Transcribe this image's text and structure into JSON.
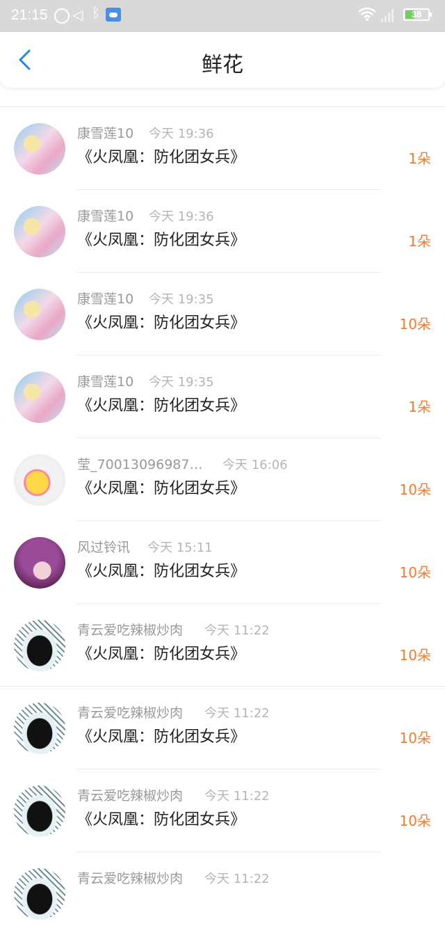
{
  "status_bar": {
    "time": "21:15",
    "battery": "38",
    "icons": [
      "alarm-icon",
      "mute-icon",
      "bluetooth-icon",
      "cloud-icon",
      "wifi-icon",
      "signal-icon",
      "battery-icon"
    ]
  },
  "header": {
    "title": "鲜花",
    "back_icon": "back-chevron-icon"
  },
  "colors": {
    "amount": "#f57c2c",
    "back_icon": "#1e88e5",
    "status_bar_bg": "#d9d9d9"
  },
  "items": [
    {
      "name": "康雪莲10",
      "time": "今天 19:36",
      "book": "《火凤凰：防化团女兵》",
      "amount": "1朵",
      "avatar": "anime-avatar"
    },
    {
      "name": "康雪莲10",
      "time": "今天 19:36",
      "book": "《火凤凰：防化团女兵》",
      "amount": "1朵",
      "avatar": "anime-avatar"
    },
    {
      "name": "康雪莲10",
      "time": "今天 19:35",
      "book": "《火凤凰：防化团女兵》",
      "amount": "10朵",
      "avatar": "anime-avatar"
    },
    {
      "name": "康雪莲10",
      "time": "今天 19:35",
      "book": "《火凤凰：防化团女兵》",
      "amount": "1朵",
      "avatar": "anime-avatar"
    },
    {
      "name": "莹_700130969870...",
      "time": "今天 16:06",
      "book": "《火凤凰：防化团女兵》",
      "amount": "10朵",
      "avatar": "duck-avatar"
    },
    {
      "name": "风过铃讯",
      "time": "今天 15:11",
      "book": "《火凤凰：防化团女兵》",
      "amount": "10朵",
      "avatar": "purple-avatar"
    },
    {
      "name": "青云爱吃辣椒炒肉",
      "time": "今天 11:22",
      "book": "《火凤凰：防化团女兵》",
      "amount": "10朵",
      "avatar": "helmet-avatar"
    },
    {
      "name": "青云爱吃辣椒炒肉",
      "time": "今天 11:22",
      "book": "《火凤凰：防化团女兵》",
      "amount": "10朵",
      "avatar": "helmet-avatar"
    },
    {
      "name": "青云爱吃辣椒炒肉",
      "time": "今天 11:22",
      "book": "《火凤凰：防化团女兵》",
      "amount": "10朵",
      "avatar": "helmet-avatar"
    },
    {
      "name": "青云爱吃辣椒炒肉",
      "time": "今天 11:22",
      "book": "",
      "amount": "",
      "avatar": "helmet-avatar"
    }
  ]
}
